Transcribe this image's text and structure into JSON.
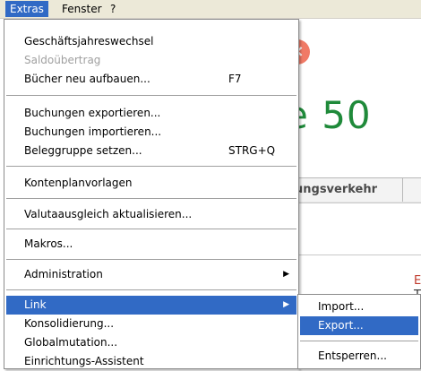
{
  "menubar": {
    "items": [
      "Extras",
      "Fenster",
      "?"
    ]
  },
  "background": {
    "app_title": "e 50",
    "tab_label": "ungsverkehr",
    "close_symbol": "×",
    "right_edge_text_1": "E",
    "right_edge_text_2": "T"
  },
  "extras_menu": {
    "items": [
      {
        "label": "Geschäftsjahreswechsel",
        "shortcut": ""
      },
      {
        "label": "Saldoübertrag",
        "shortcut": "",
        "disabled": true
      },
      {
        "label": "Bücher neu aufbauen...",
        "shortcut": "F7"
      },
      {
        "label": "Buchungen exportieren...",
        "shortcut": ""
      },
      {
        "label": "Buchungen importieren...",
        "shortcut": ""
      },
      {
        "label": "Beleggruppe setzen...",
        "shortcut": "STRG+Q"
      },
      {
        "label": "Kontenplanvorlagen",
        "shortcut": ""
      },
      {
        "label": "Valutaausgleich aktualisieren...",
        "shortcut": ""
      },
      {
        "label": "Makros...",
        "shortcut": ""
      },
      {
        "label": "Administration",
        "shortcut": "",
        "submenu": true
      },
      {
        "label": "Link",
        "shortcut": "",
        "submenu": true,
        "highlight": true
      },
      {
        "label": "Konsolidierung...",
        "shortcut": ""
      },
      {
        "label": "Globalmutation...",
        "shortcut": ""
      },
      {
        "label": "Einrichtungs-Assistent",
        "shortcut": ""
      }
    ]
  },
  "link_submenu": {
    "items": [
      {
        "label": "Import..."
      },
      {
        "label": "Export...",
        "highlight": true
      },
      {
        "label": "Entsperren..."
      }
    ]
  },
  "colors": {
    "highlight": "#316ac5",
    "title_green": "#1f8a3a",
    "menubar_bg": "#ece9d8"
  }
}
